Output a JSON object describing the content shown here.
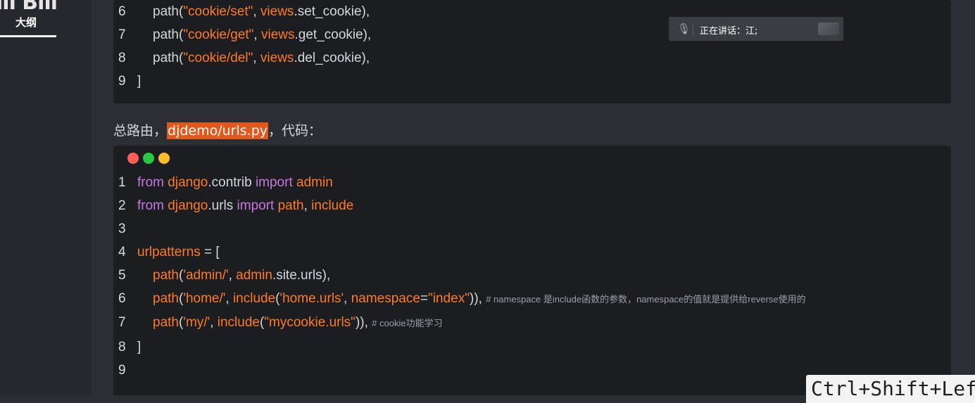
{
  "sidebar": {
    "logo_text": "bilibili",
    "outline_label": "大纲"
  },
  "block1": {
    "lines": [
      {
        "num": "6",
        "parts": [
          [
            "pl",
            "path("
          ],
          [
            "or",
            "\"cookie/set\""
          ],
          [
            "pl",
            ", "
          ],
          [
            "or",
            "views"
          ],
          [
            "pl",
            ".set_cookie),"
          ]
        ]
      },
      {
        "num": "7",
        "parts": [
          [
            "pl",
            "path("
          ],
          [
            "or",
            "\"cookie/get\""
          ],
          [
            "pl",
            ", "
          ],
          [
            "or",
            "views"
          ],
          [
            "pl",
            ".get_cookie),"
          ]
        ]
      },
      {
        "num": "8",
        "parts": [
          [
            "pl",
            "path("
          ],
          [
            "or",
            "\"cookie/del\""
          ],
          [
            "pl",
            ", "
          ],
          [
            "or",
            "views"
          ],
          [
            "pl",
            ".del_cookie),"
          ]
        ]
      },
      {
        "num": "9",
        "parts": [
          [
            "pl",
            "]"
          ]
        ]
      }
    ]
  },
  "prose": {
    "before": "总路由，",
    "highlight": "djdemo/urls.py",
    "after": "，代码："
  },
  "block2": {
    "dot_colors": [
      "#ff5f57",
      "#28c840",
      "#febc2e"
    ],
    "lines": [
      {
        "num": "1",
        "parts": [
          [
            "kw",
            "from "
          ],
          [
            "or",
            "django"
          ],
          [
            "pl",
            ".contrib "
          ],
          [
            "kw",
            "import "
          ],
          [
            "or",
            "admin"
          ]
        ]
      },
      {
        "num": "2",
        "parts": [
          [
            "kw",
            "from "
          ],
          [
            "or",
            "django"
          ],
          [
            "pl",
            ".urls "
          ],
          [
            "kw",
            "import "
          ],
          [
            "or",
            "path"
          ],
          [
            "pl",
            ", "
          ],
          [
            "or",
            "include"
          ]
        ]
      },
      {
        "num": "3",
        "parts": []
      },
      {
        "num": "4",
        "parts": [
          [
            "or",
            "urlpatterns"
          ],
          [
            "pl",
            " = ["
          ]
        ]
      },
      {
        "num": "5",
        "parts": [
          [
            "or",
            "path"
          ],
          [
            "pl",
            "("
          ],
          [
            "or",
            "'admin/'"
          ],
          [
            "pl",
            ", "
          ],
          [
            "or",
            "admin"
          ],
          [
            "pl",
            ".site.urls),"
          ]
        ]
      },
      {
        "num": "6",
        "parts": [
          [
            "or",
            "path"
          ],
          [
            "pl",
            "("
          ],
          [
            "or",
            "'home/'"
          ],
          [
            "pl",
            ", "
          ],
          [
            "or",
            "include"
          ],
          [
            "pl",
            "("
          ],
          [
            "or",
            "'home.urls'"
          ],
          [
            "pl",
            ", "
          ],
          [
            "or",
            "namespace"
          ],
          [
            "pl",
            "="
          ],
          [
            "or",
            "\"index\""
          ],
          [
            "pl",
            ")),  "
          ],
          [
            "cm",
            "# namespace 是include函数的参数，namespace的值就是提供给reverse使用的"
          ]
        ]
      },
      {
        "num": "7",
        "parts": [
          [
            "or",
            "path"
          ],
          [
            "pl",
            "("
          ],
          [
            "or",
            "'my/'"
          ],
          [
            "pl",
            ", "
          ],
          [
            "or",
            "include"
          ],
          [
            "pl",
            "("
          ],
          [
            "or",
            "\"mycookie.urls\""
          ],
          [
            "pl",
            ")), "
          ],
          [
            "cm",
            "# cookie功能学习"
          ]
        ]
      },
      {
        "num": "8",
        "parts": [
          [
            "pl",
            "]"
          ]
        ]
      },
      {
        "num": "9",
        "parts": []
      }
    ]
  },
  "speaking": {
    "text": "正在讲话：江;"
  },
  "shortcut": {
    "text": "Ctrl+Shift+Left"
  }
}
